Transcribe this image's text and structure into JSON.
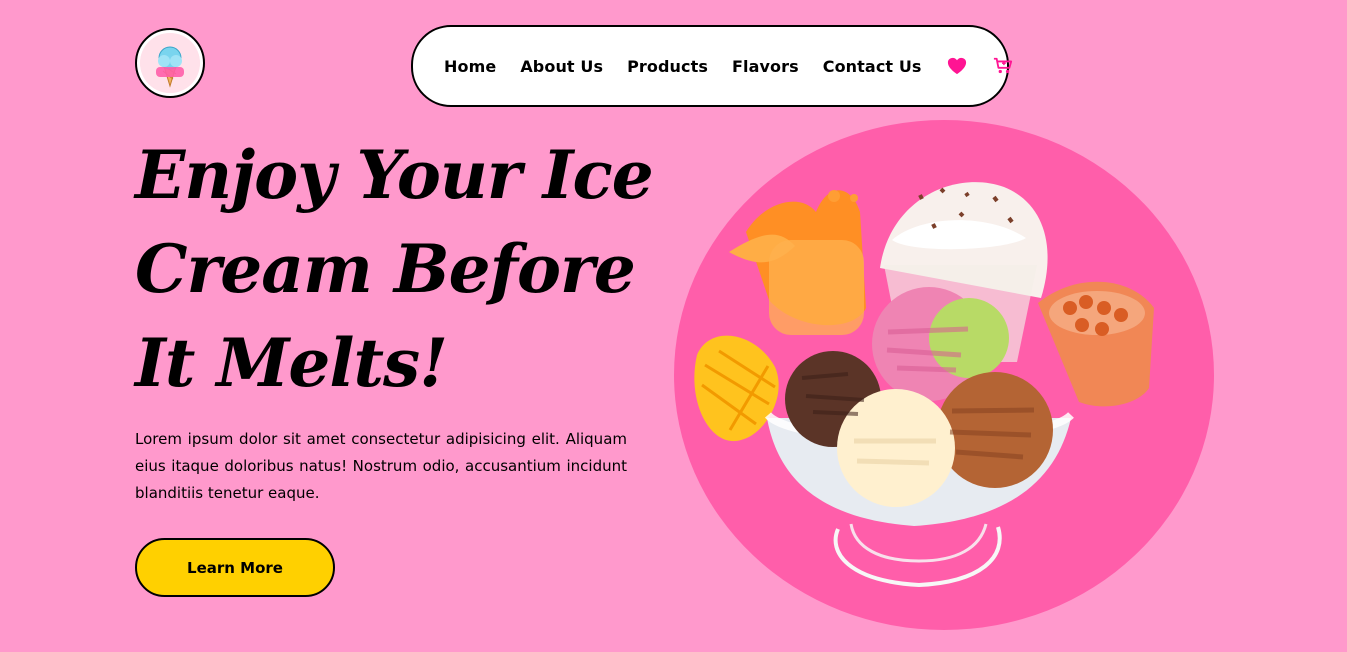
{
  "logo": {
    "text": "Ice Cream"
  },
  "nav": {
    "items": [
      {
        "label": "Home"
      },
      {
        "label": "About Us"
      },
      {
        "label": "Products"
      },
      {
        "label": "Flavors"
      },
      {
        "label": "Contact Us"
      }
    ],
    "favorites_icon": "heart-icon",
    "cart_icon": "cart-icon"
  },
  "hero": {
    "title": "Enjoy Your Ice Cream Before It Melts!",
    "description": "Lorem ipsum dolor sit amet consectetur adipisicing elit. Aliquam eius itaque doloribus natus! Nostrum odio, accusantium incidunt blanditiis tenetur eaque.",
    "button_label": "Learn More"
  },
  "colors": {
    "background": "#ff99cc",
    "circle": "#ff5eaa",
    "accent": "#ff1493",
    "button": "#ffd000"
  }
}
